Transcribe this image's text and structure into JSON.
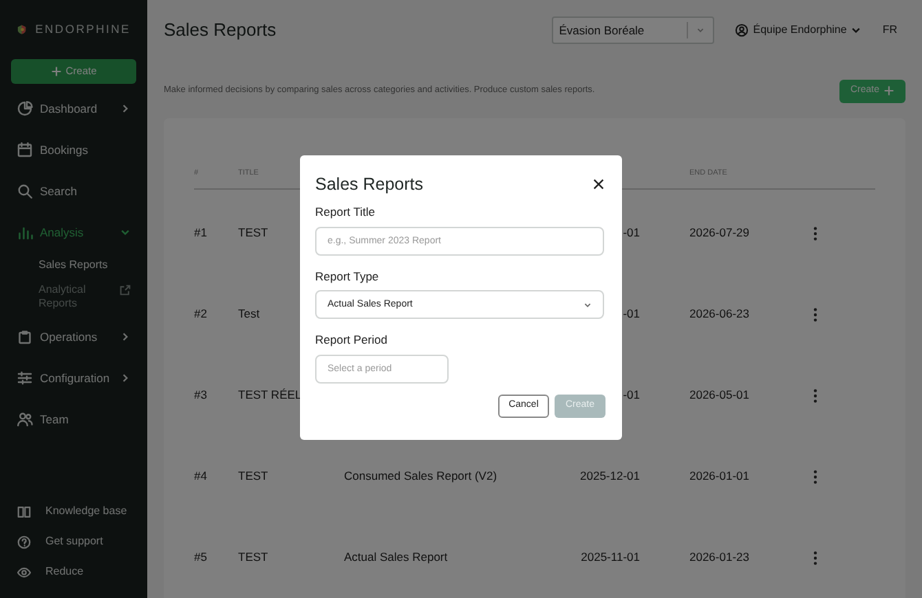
{
  "brand": "ENDORPHINE",
  "sidebar": {
    "create_button": "Create",
    "items": [
      {
        "label": "Dashboard",
        "selected": false,
        "expanded": false
      },
      {
        "label": "Bookings",
        "selected": false
      },
      {
        "label": "Search",
        "selected": false
      },
      {
        "label": "Analysis",
        "selected": true,
        "expanded": true,
        "children": [
          {
            "label": "Sales Reports",
            "selected": true,
            "external": false
          },
          {
            "label": "Analytical Reports",
            "selected": false,
            "external": true
          }
        ]
      },
      {
        "label": "Operations",
        "selected": false,
        "expanded": false
      },
      {
        "label": "Configuration",
        "selected": false,
        "expanded": false
      },
      {
        "label": "Team",
        "selected": false
      }
    ],
    "footer_items": [
      "Knowledge base",
      "Get support",
      "Reduce"
    ]
  },
  "header": {
    "title": "Sales Reports",
    "organization_select": "Évasion Boréale",
    "user_menu": "Équipe Endorphine",
    "language": "FR"
  },
  "description": "Make informed decisions by comparing sales across categories and activities. Produce custom sales reports.",
  "create_button": "Create",
  "table": {
    "columns": [
      "#",
      "TITLE",
      "END DATE"
    ],
    "rows": [
      {
        "number": "#1",
        "title": "TEST",
        "start_date": "-01",
        "end_date": "2026-07-29"
      },
      {
        "number": "#2",
        "title": "Test",
        "start_date": "-01",
        "end_date": "2026-06-23"
      },
      {
        "number": "#3",
        "title": "TEST RÉEL",
        "start_date": "-01",
        "end_date": "2026-05-01"
      },
      {
        "number": "#4",
        "title": "TEST",
        "type": "Consumed Sales Report (V2)",
        "start_date": "2025-12-01",
        "end_date": "2026-01-01"
      },
      {
        "number": "#5",
        "title": "TEST",
        "type": "Actual Sales Report",
        "start_date": "2025-11-01",
        "end_date": "2026-01-23"
      }
    ]
  },
  "dialog": {
    "title": "Sales Reports",
    "fields": [
      {
        "label": "Report Title",
        "kind": "text",
        "placeholder": "e.g., Summer 2023 Report"
      },
      {
        "label": "Report Type",
        "kind": "select",
        "value": "Actual Sales Report"
      },
      {
        "label": "Report Period",
        "kind": "period",
        "placeholder": "Select a period"
      }
    ],
    "buttons": [
      {
        "label": "Cancel",
        "kind": "secondary",
        "disabled": false
      },
      {
        "label": "Create",
        "kind": "primary",
        "disabled": true
      }
    ]
  }
}
